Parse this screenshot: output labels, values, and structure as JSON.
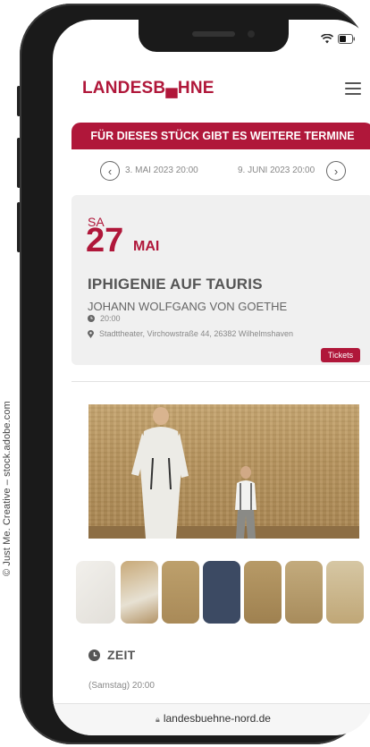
{
  "credit": "© Just Me. Creative – stock.adobe.com",
  "header": {
    "logo": "LANDESB▄HNE"
  },
  "banner": {
    "text": "FÜR DIESES STÜCK GIBT ES WEITERE TERMINE"
  },
  "dates": {
    "prev": "3. MAI 2023 20:00",
    "next": "9. JUNI 2023 20:00"
  },
  "event": {
    "weekday": "SA",
    "day": "27",
    "month": "MAI",
    "title": "IPHIGENIE AUF TAURIS",
    "author": "JOHANN WOLFGANG VON GOETHE",
    "time": "20:00",
    "venue": "Stadttheater, Virchowstraße 44, 26382 Wilhelmshaven",
    "tickets_label": "Tickets"
  },
  "zeit": {
    "label": "ZEIT",
    "value": "(Samstag) 20:00"
  },
  "browser": {
    "url": "landesbuehne-nord.de"
  },
  "colors": {
    "accent": "#b0173a"
  }
}
